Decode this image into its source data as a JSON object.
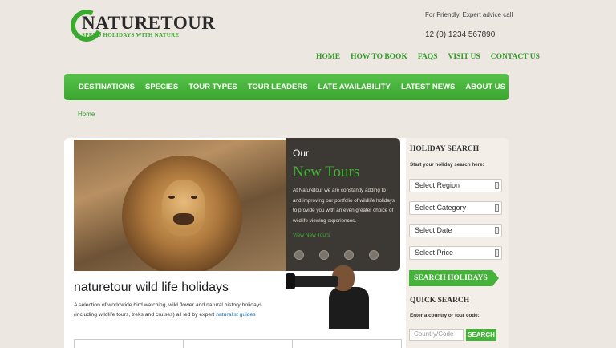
{
  "brand": {
    "name": "NATURETOUR",
    "tagline": "SPEND HOLIDAYS WITH NATURE",
    "accent": "#3aaa2e"
  },
  "contact": {
    "note": "For Friendly, Expert advice call",
    "phone": "12 (0) 1234 567890"
  },
  "top_links": [
    "HOME",
    "HOW TO BOOK",
    "FAQS",
    "VISIT US",
    "CONTACT US"
  ],
  "main_nav": [
    "DESTINATIONS",
    "SPECIES",
    "TOUR TYPES",
    "TOUR LEADERS",
    "LATE AVAILABILITY",
    "LATEST NEWS",
    "ABOUT US"
  ],
  "breadcrumb": "Home",
  "promo": {
    "our": "Our",
    "title": "New Tours",
    "text": "At Naturetour we are constantly adding to and improving our portfolio of wildlife holidays to provide you with an even greater choice of wildlife viewing experiences.",
    "link": "View New Tours",
    "dot_count": 4
  },
  "intro": {
    "title": "naturetour wild life holidays",
    "text": "A selection of worldwide bird watching, wild flower and natural history holidays (including wildlife tours, treks and cruises) all led by expert",
    "link": "naturalist guides"
  },
  "sidebar": {
    "holiday_search_title": "HOLIDAY SEARCH",
    "holiday_search_sub": "Start your holiday search here:",
    "selects": [
      "Select Region",
      "Select Category",
      "Select Date",
      "Select Price"
    ],
    "search_button": "SEARCH HOLIDAYS",
    "quick_title": "QUICK SEARCH",
    "quick_sub": "Enter a country or tour code:",
    "quick_placeholder": "Country/Code",
    "quick_button": "SEARCH"
  }
}
